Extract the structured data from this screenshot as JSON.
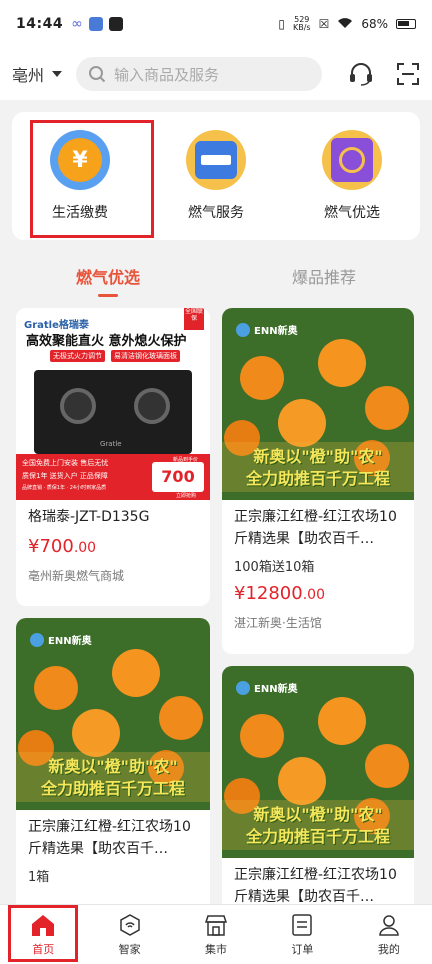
{
  "status_bar": {
    "time": "14:44",
    "net_speed_value": "529",
    "net_speed_unit": "KB/s",
    "battery": "68%",
    "icons": [
      "infinity-icon",
      "shield-app-icon",
      "ai-app-icon",
      "vibrate-icon",
      "wifi-icon",
      "sim-off-icon",
      "battery-icon"
    ]
  },
  "header": {
    "city": "亳州",
    "search_placeholder": "输入商品及服务",
    "icons": [
      "customer-service-icon",
      "scan-icon"
    ]
  },
  "services": [
    {
      "label": "生活缴费",
      "icon": "yuan-coin-icon",
      "color": "#f7a21b"
    },
    {
      "label": "燃气服务",
      "icon": "gas-meter-icon",
      "color": "#3d7be0"
    },
    {
      "label": "燃气优选",
      "icon": "gas-select-icon",
      "color": "#8a4fd8"
    }
  ],
  "tabs": [
    {
      "label": "燃气优选",
      "active": true
    },
    {
      "label": "爆品推荐",
      "active": false
    }
  ],
  "products": [
    {
      "title": "格瑞泰-JZT-D135G",
      "price_main": "¥700",
      "price_decimal": ".00",
      "shop": "亳州新奥燃气商城",
      "image": {
        "brand": "Gratle格瑞泰",
        "corner_badge": "全国联保",
        "slogan": "高效聚能直火  意外熄火保护",
        "tags": [
          "无极式火力调节",
          "易清洁钢化玻璃面板"
        ],
        "stove_brand": "Gratle",
        "bottom_lines": [
          "全国免费上门安装  售后无忧",
          "质保1年  送货入户  正品保障"
        ],
        "footer_note": "品牌直销 · 质保1年 · 24小时到家品质",
        "price_label": "新品到手价",
        "price_value": "700",
        "buy_label": "立即抢购"
      }
    },
    {
      "title": "正宗廉江红橙-红江农场10斤精选果【助农百千…",
      "subtitle": "100箱送10箱",
      "price_main": "¥12800",
      "price_decimal": ".00",
      "shop": "湛江新奥·生活馆",
      "image": {
        "logo": "ENN新奥",
        "banner_line1": "新奥以\"橙\"助\"农\"",
        "banner_line2": "全力助推百千万工程"
      }
    },
    {
      "title": "正宗廉江红橙-红江农场10斤精选果【助农百千…",
      "subtitle": "1箱",
      "image": {
        "logo": "ENN新奥",
        "banner_line1": "新奥以\"橙\"助\"农\"",
        "banner_line2": "全力助推百千万工程"
      }
    },
    {
      "title": "正宗廉江红橙-红江农场10斤精选果【助农百千…",
      "image": {
        "logo": "ENN新奥",
        "banner_line1": "新奥以\"橙\"助\"农\"",
        "banner_line2": "全力助推百千万工程"
      }
    }
  ],
  "bottom_nav": [
    {
      "label": "首页",
      "icon": "home-icon",
      "active": true
    },
    {
      "label": "智家",
      "icon": "smart-home-icon",
      "active": false
    },
    {
      "label": "集市",
      "icon": "market-icon",
      "active": false
    },
    {
      "label": "订单",
      "icon": "order-icon",
      "active": false
    },
    {
      "label": "我的",
      "icon": "profile-icon",
      "active": false
    }
  ],
  "colors": {
    "accent": "#e8543a",
    "price": "#e2242a",
    "highlight_box": "#e2242a"
  }
}
